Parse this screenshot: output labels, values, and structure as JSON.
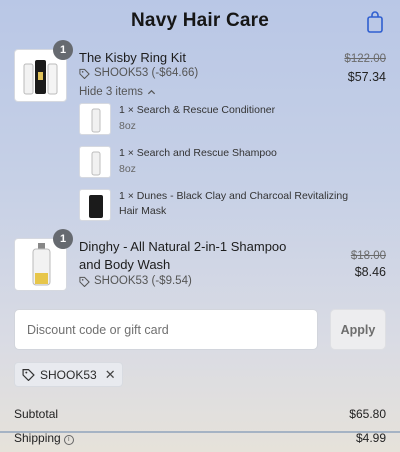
{
  "header": {
    "title": "Navy Hair Care",
    "cart_icon": "shopping-bag-icon"
  },
  "items": [
    {
      "quantity": "1",
      "name": "The Kisby Ring Kit",
      "discount": "SHOOK53 (-$64.66)",
      "price_original": "$122.00",
      "price_final": "$57.34",
      "toggle_label": "Hide 3 items",
      "components": [
        {
          "text": "1 × Search & Rescue Conditioner",
          "variant": "8oz"
        },
        {
          "text": "1 × Search and Rescue Shampoo",
          "variant": "8oz"
        },
        {
          "text": "1 × Dunes - Black Clay and Charcoal Revitalizing Hair Mask",
          "variant": ""
        }
      ]
    },
    {
      "quantity": "1",
      "name": "Dinghy - All Natural 2-in-1 Shampoo and Body Wash",
      "discount": "SHOOK53 (-$9.54)",
      "price_original": "$18.00",
      "price_final": "$8.46"
    }
  ],
  "discount_form": {
    "placeholder": "Discount code or gift card",
    "value": "",
    "apply_label": "Apply"
  },
  "applied_code": "SHOOK53",
  "summary": {
    "subtotal_label": "Subtotal",
    "subtotal_value": "$65.80",
    "shipping_label": "Shipping",
    "shipping_value": "$4.99"
  }
}
